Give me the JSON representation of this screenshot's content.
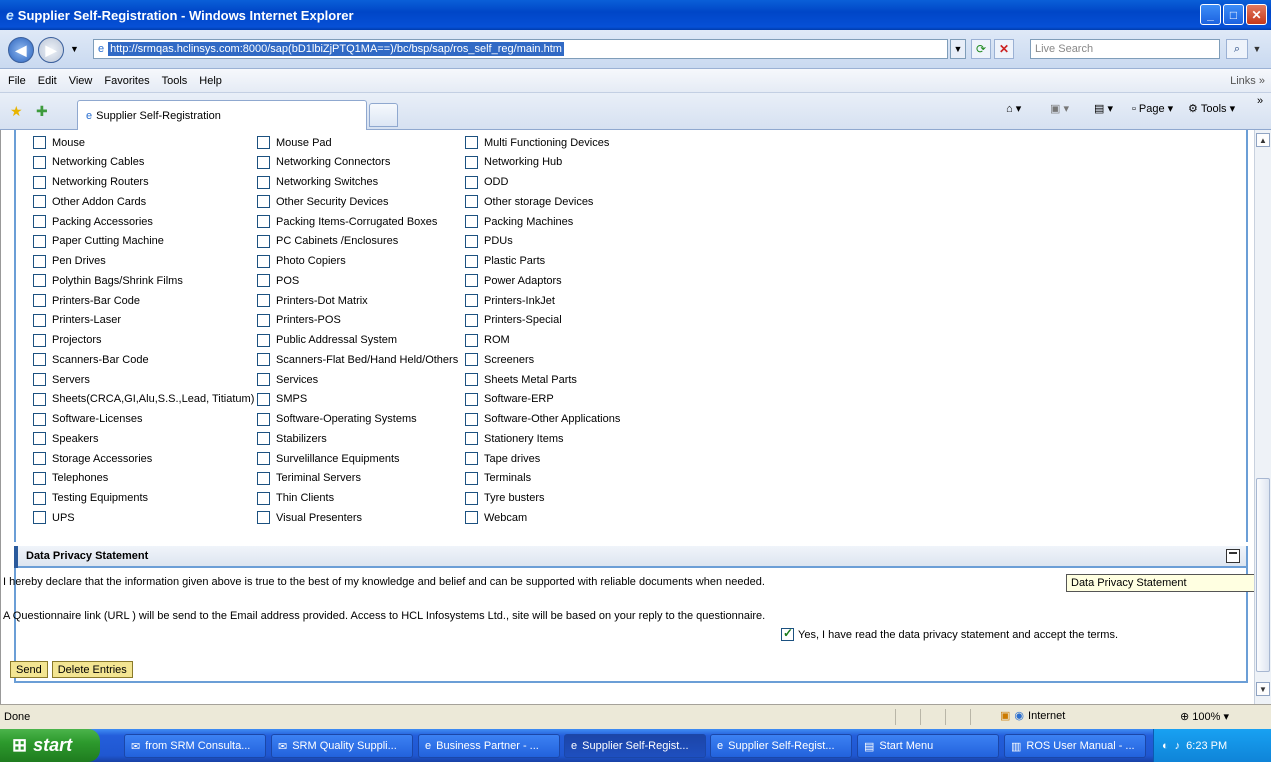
{
  "window": {
    "title": "Supplier Self-Registration - Windows Internet Explorer"
  },
  "address": {
    "url": "http://srmqas.hclinsys.com:8000/sap(bD1lbiZjPTQ1MA==)/bc/bsp/sap/ros_self_reg/main.htm"
  },
  "search": {
    "placeholder": "Live Search"
  },
  "menu": [
    "File",
    "Edit",
    "View",
    "Favorites",
    "Tools",
    "Help"
  ],
  "menu_links": "Links",
  "tab": {
    "label": "Supplier Self-Registration"
  },
  "commands": {
    "page": "Page",
    "tools": "Tools"
  },
  "categories": [
    [
      "Mouse",
      "Mouse Pad",
      "Multi Functioning Devices"
    ],
    [
      "Networking Cables",
      "Networking Connectors",
      "Networking Hub"
    ],
    [
      "Networking Routers",
      "Networking Switches",
      "ODD"
    ],
    [
      "Other Addon Cards",
      "Other Security Devices",
      "Other storage Devices"
    ],
    [
      "Packing Accessories",
      "Packing Items-Corrugated Boxes",
      "Packing Machines"
    ],
    [
      "Paper Cutting Machine",
      "PC Cabinets /Enclosures",
      "PDUs"
    ],
    [
      "Pen Drives",
      "Photo Copiers",
      "Plastic Parts"
    ],
    [
      "Polythin Bags/Shrink Films",
      "POS",
      "Power Adaptors"
    ],
    [
      "Printers-Bar Code",
      "Printers-Dot Matrix",
      "Printers-InkJet"
    ],
    [
      "Printers-Laser",
      "Printers-POS",
      "Printers-Special"
    ],
    [
      "Projectors",
      "Public Addressal System",
      "ROM"
    ],
    [
      "Scanners-Bar Code",
      "Scanners-Flat Bed/Hand Held/Others",
      "Screeners"
    ],
    [
      "Servers",
      "Services",
      "Sheets Metal Parts"
    ],
    [
      "Sheets(CRCA,GI,Alu,S.S.,Lead, Titiatum)",
      "SMPS",
      "Software-ERP"
    ],
    [
      "Software-Licenses",
      "Software-Operating Systems",
      "Software-Other Applications"
    ],
    [
      "Speakers",
      "Stabilizers",
      "Stationery Items"
    ],
    [
      "Storage Accessories",
      "Survelillance Equipments",
      "Tape drives"
    ],
    [
      "Telephones",
      "Teriminal Servers",
      "Terminals"
    ],
    [
      "Testing Equipments",
      "Thin Clients",
      "Tyre busters"
    ],
    [
      "UPS",
      "Visual Presenters",
      "Webcam"
    ]
  ],
  "privacy": {
    "title": "Data Privacy Statement",
    "text1": "I hereby declare that the information given above is true to the best of my knowledge and belief and can be supported with reliable documents when needed.",
    "text2": "A Questionnaire link (URL ) will be send to the Email address provided. Access to HCL Infosystems Ltd., site will be based on your reply to the questionnaire.",
    "accept_label": "Yes, I have read the data privacy statement and accept the terms.",
    "tooltip": "Data Privacy Statement"
  },
  "actions": {
    "send": "Send",
    "delete": "Delete Entries"
  },
  "status": {
    "text": "Done",
    "zone": "Internet",
    "zoom": "100%"
  },
  "taskbar": {
    "start": "start",
    "tasks": [
      "from SRM Consulta...",
      "SRM Quality Suppli...",
      "Business Partner - ...",
      "Supplier Self-Regist...",
      "Supplier Self-Regist...",
      "Start Menu",
      "ROS User Manual - ..."
    ],
    "clock": "6:23 PM"
  }
}
